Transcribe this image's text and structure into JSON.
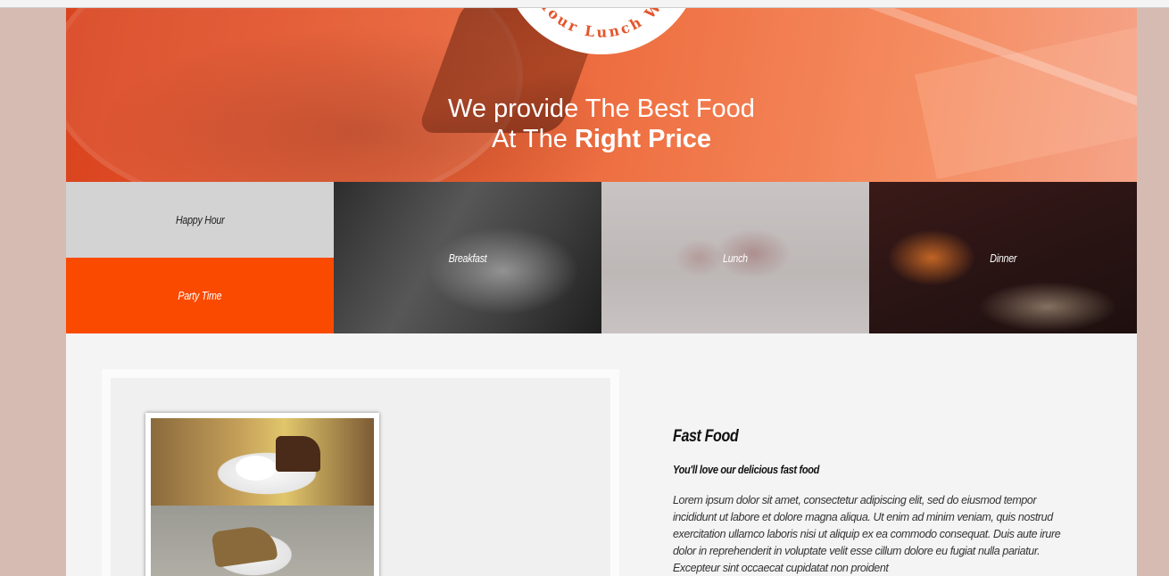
{
  "hero": {
    "logo_text": "Your Lunch W",
    "title_line1": "We provide The Best Food",
    "title_line2_prefix": "At The",
    "title_line2_bold": "Right Price"
  },
  "categories": {
    "happy_hour": "Happy Hour",
    "party_time": "Party Time",
    "breakfast": "Breakfast",
    "lunch": "Lunch",
    "dinner": "Dinner"
  },
  "feature": {
    "title": "Fast Food",
    "subtitle": "You'll love our delicious fast food",
    "body": "Lorem ipsum dolor sit amet, consectetur adipiscing elit, sed do eiusmod tempor incididunt ut labore et dolore magna aliqua. Ut enim ad minim veniam, quis nostrud exercitation ullamco laboris nisi ut aliquip ex ea commodo consequat. Duis aute irure dolor in reprehenderit in voluptate velit esse cillum dolore eu fugiat nulla pariatur. Excepteur sint occaecat cupidatat non proident"
  },
  "colors": {
    "accent": "#fa4a00",
    "hero_orange": "#e4562c",
    "side_background": "#d6bbb2"
  }
}
